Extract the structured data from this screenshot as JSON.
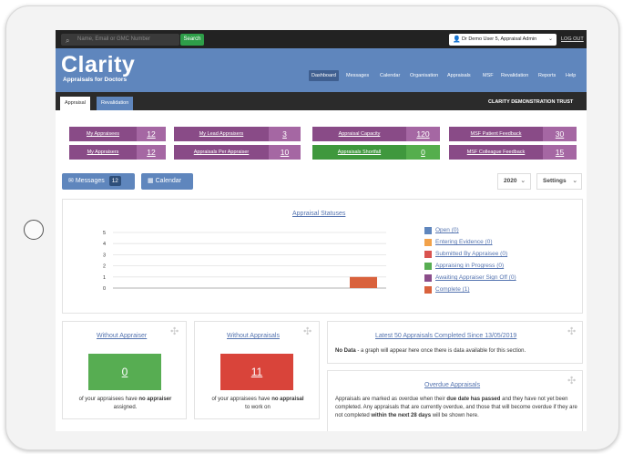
{
  "topbar": {
    "search_placeholder": "Name, Email or GMC Number",
    "search_button": "Search",
    "user": "Dr Demo User 5, Appraisal Admin",
    "logout": "LOG OUT"
  },
  "brand": {
    "logo": "Clarity",
    "tagline": "Appraisals for Doctors"
  },
  "nav": [
    "Dashboard",
    "Messages",
    "Calendar",
    "Organisation",
    "Appraisals",
    "MSF",
    "Revalidation",
    "Reports",
    "Help"
  ],
  "tabs": [
    "Appraisal",
    "Revalidation"
  ],
  "trust": "CLARITY DEMONSTRATION TRUST",
  "stats": [
    {
      "label": "My Appraisees",
      "value": "12"
    },
    {
      "label": "My Lead Appraisers",
      "value": "3"
    },
    {
      "label": "Appraisal Capacity",
      "value": "120"
    },
    {
      "label": "MSF Patient Feedback",
      "value": "30"
    },
    {
      "label": "My Appraisers",
      "value": "12"
    },
    {
      "label": "Appraisals Per Appraiser",
      "value": "10"
    },
    {
      "label": "Appraisals Shortfall",
      "value": "0"
    },
    {
      "label": "MSF Colleague Feedback",
      "value": "15"
    }
  ],
  "toolbar": {
    "messages_label": "Messages",
    "messages_count": "12",
    "calendar_label": "Calendar",
    "year": "2020",
    "settings": "Settings"
  },
  "chart_data": {
    "type": "bar",
    "title": "Appraisal Statuses",
    "categories": [
      "Open",
      "Entering Evidence",
      "Submitted By Appraisee",
      "Appraising in Progress",
      "Awaiting Appraiser Sign Off",
      "Complete"
    ],
    "values": [
      0,
      0,
      0,
      0,
      0,
      1
    ],
    "ylim": [
      0,
      5
    ],
    "yticks": [
      "0",
      "1",
      "2",
      "3",
      "4",
      "5"
    ],
    "legend": [
      "Open (0)",
      "Entering Evidence (0)",
      "Submitted By Appraisee (0)",
      "Appraising in Progress (0)",
      "Awaiting Appraiser Sign Off (0)",
      "Complete (1)"
    ],
    "colors": [
      "#5f86bd",
      "#f2a24a",
      "#d9534f",
      "#57ad52",
      "#8b4d8a",
      "#d9623d"
    ]
  },
  "panels": {
    "without_appraiser": {
      "title": "Without Appraiser",
      "value": "0",
      "desc_pre": "of your appraisees have",
      "desc_bold": "no appraiser",
      "desc_post": "assigned."
    },
    "without_appraisals": {
      "title": "Without Appraisals",
      "value": "11",
      "desc_pre": "of your appraisees have",
      "desc_bold": "no appraisal",
      "desc_post": "to work on"
    },
    "latest": {
      "title": "Latest 50 Appraisals Completed Since 13/05/2019",
      "bold": "No Data",
      "text": " - a graph will appear here once there is data available for this section."
    },
    "overdue": {
      "title": "Overdue Appraisals",
      "t1": "Appraisals are marked as overdue when their",
      "t1b": "due date has passed",
      "t2": "and they have not yet been completed. Any appraisals that are currently overdue, and those that will become overdue if they are not completed",
      "t2b": "within the next 28 days",
      "t3": "will be shown here."
    }
  }
}
